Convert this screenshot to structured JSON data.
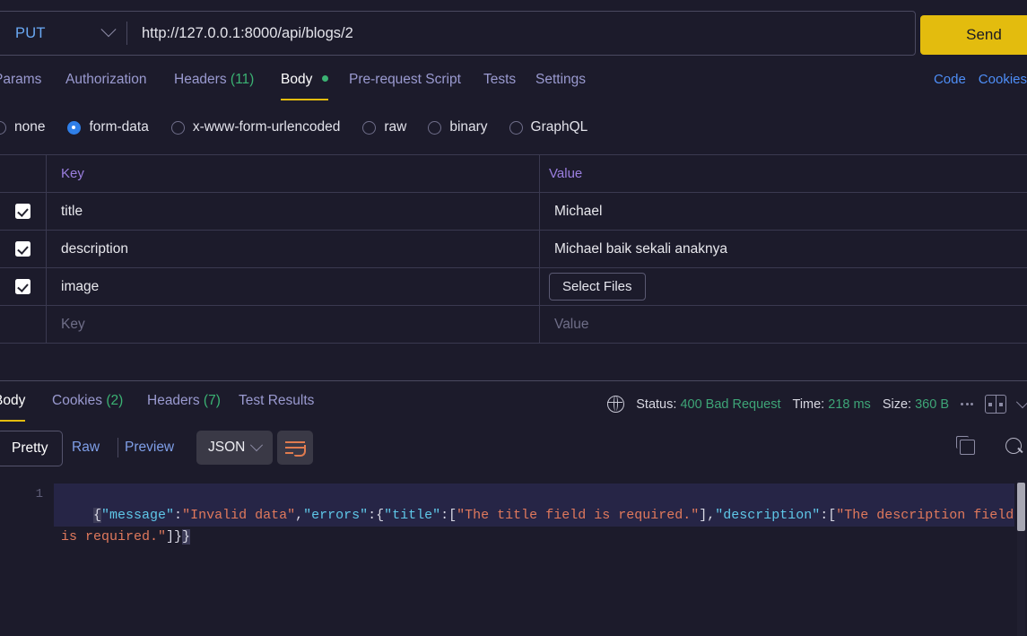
{
  "request": {
    "method": "PUT",
    "url": "http://127.0.0.1:8000/api/blogs/2",
    "send_label": "Send",
    "tabs": [
      {
        "label": "Params",
        "count": "",
        "active": false
      },
      {
        "label": "Authorization",
        "count": "",
        "active": false
      },
      {
        "label": "Headers",
        "count": "(11)",
        "active": false
      },
      {
        "label": "Body",
        "count": "",
        "active": true
      },
      {
        "label": "Pre-request Script",
        "count": "",
        "active": false
      },
      {
        "label": "Tests",
        "count": "",
        "active": false
      },
      {
        "label": "Settings",
        "count": "",
        "active": false
      }
    ],
    "right_links": [
      "Code",
      "Cookies"
    ],
    "body_types": [
      {
        "label": "none",
        "selected": false
      },
      {
        "label": "form-data",
        "selected": true
      },
      {
        "label": "x-www-form-urlencoded",
        "selected": false
      },
      {
        "label": "raw",
        "selected": false
      },
      {
        "label": "binary",
        "selected": false
      },
      {
        "label": "GraphQL",
        "selected": false
      }
    ],
    "table": {
      "columns": [
        "Key",
        "Value"
      ],
      "rows": [
        {
          "checked": true,
          "key": "title",
          "value": "Michael",
          "type": "text"
        },
        {
          "checked": true,
          "key": "description",
          "value": "Michael baik sekali anaknya",
          "type": "text"
        },
        {
          "checked": true,
          "key": "image",
          "value": "Select Files",
          "type": "file"
        }
      ],
      "placeholder_key": "Key",
      "placeholder_value": "Value"
    }
  },
  "response": {
    "tabs": [
      {
        "label": "Body",
        "count": "",
        "active": true
      },
      {
        "label": "Cookies",
        "count": "(2)",
        "active": false
      },
      {
        "label": "Headers",
        "count": "(7)",
        "active": false
      },
      {
        "label": "Test Results",
        "count": "",
        "active": false
      }
    ],
    "status": {
      "status_label": "Status:",
      "status_value": "400 Bad Request",
      "time_label": "Time:",
      "time_value": "218 ms",
      "size_label": "Size:",
      "size_value": "360 B"
    },
    "toolbar": {
      "pretty": "Pretty",
      "raw": "Raw",
      "preview": "Preview",
      "format": "JSON"
    },
    "line_number": "1",
    "json": {
      "message": "Invalid data",
      "errors": {
        "title": [
          "The title field is required."
        ],
        "description": [
          "The description field is required."
        ]
      }
    }
  },
  "colors": {
    "accent_send": "#e3bc0e",
    "status_green": "#3ea577",
    "link_blue": "#4e8ef7",
    "radio_blue": "#2f7fe8",
    "background": "#1c1b2b"
  }
}
